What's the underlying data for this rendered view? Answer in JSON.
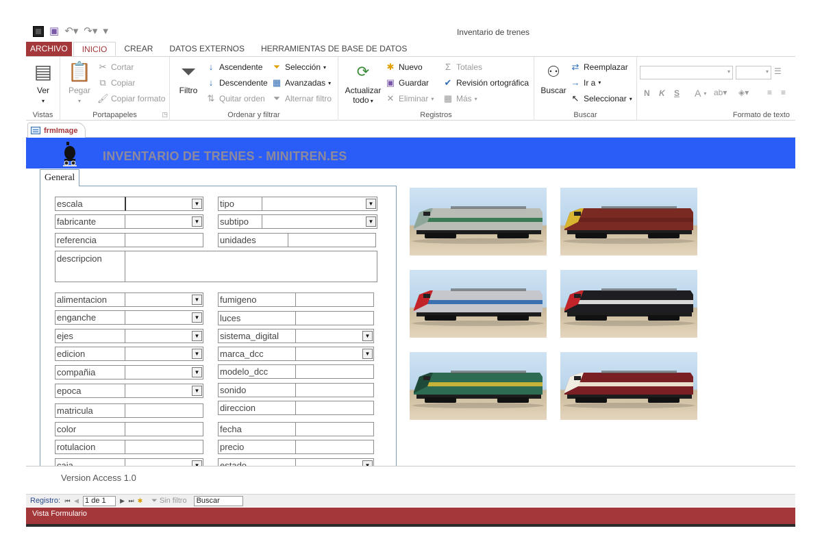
{
  "window": {
    "title": "Inventario de trenes"
  },
  "qat": {
    "icons": [
      "access-app-icon",
      "save-icon",
      "undo-icon",
      "redo-icon",
      "customize-icon"
    ]
  },
  "ribbon": {
    "tabs": [
      "ARCHIVO",
      "INICIO",
      "CREAR",
      "DATOS EXTERNOS",
      "HERRAMIENTAS DE BASE DE DATOS"
    ],
    "active_tab": "INICIO",
    "groups": {
      "vistas": {
        "label": "Vistas",
        "ver": "Ver"
      },
      "portapapeles": {
        "label": "Portapapeles",
        "pegar": "Pegar",
        "cortar": "Cortar",
        "copiar": "Copiar",
        "copiar_formato": "Copiar formato"
      },
      "ordenar": {
        "label": "Ordenar y filtrar",
        "filtro": "Filtro",
        "ascendente": "Ascendente",
        "descendente": "Descendente",
        "quitar_orden": "Quitar orden",
        "seleccion": "Selección",
        "avanzadas": "Avanzadas",
        "alternar_filtro": "Alternar filtro"
      },
      "registros": {
        "label": "Registros",
        "actualizar": "Actualizar",
        "todo": "todo",
        "nuevo": "Nuevo",
        "guardar": "Guardar",
        "eliminar": "Eliminar",
        "totales": "Totales",
        "revision": "Revisión ortográfica",
        "mas": "Más"
      },
      "buscar": {
        "label": "Buscar",
        "buscar": "Buscar",
        "reemplazar": "Reemplazar",
        "ir_a": "Ir a",
        "seleccionar": "Seleccionar"
      },
      "formato": {
        "label": "Formato de texto",
        "bold": "N",
        "italic": "K",
        "underline": "S",
        "font_color": "A"
      }
    }
  },
  "object_tab": {
    "name": "frmImage"
  },
  "form": {
    "title": "INVENTARIO DE TRENES - MINITREN.ES",
    "page_tab": "General",
    "fields_left": [
      "escala",
      "fabricante",
      "referencia",
      "descripcion",
      "alimentacion",
      "enganche",
      "ejes",
      "edicion",
      "compañia",
      "epoca",
      "matricula",
      "color",
      "rotulacion",
      "caja"
    ],
    "fields_right": [
      "tipo",
      "subtipo",
      "unidades",
      "fumigeno",
      "luces",
      "sistema_digital",
      "marca_dcc",
      "modelo_dcc",
      "sonido",
      "direccion",
      "fecha",
      "precio",
      "estado"
    ],
    "version": "Version Access 1.0"
  },
  "photos": [
    {
      "name": "locomotive-silver-green",
      "body": "#b9bdb6",
      "stripe": "#3c7a55",
      "accent": "#8fa79a"
    },
    {
      "name": "locomotive-brown-yellow",
      "body": "#7a2a22",
      "stripe": "#6a221c",
      "accent": "#d8b530"
    },
    {
      "name": "locomotive-grey-red",
      "body": "#c5c7cc",
      "stripe": "#3a6fb0",
      "accent": "#c2242a"
    },
    {
      "name": "locomotive-black-red",
      "body": "#1e1e22",
      "stripe": "#d9d9d9",
      "accent": "#c2242a"
    },
    {
      "name": "locomotive-green-yellow",
      "body": "#2d6b52",
      "stripe": "#c6b33a",
      "accent": "#1e4a3a"
    },
    {
      "name": "locomotive-maroon-cream",
      "body": "#7a1f24",
      "stripe": "#e8dfcf",
      "accent": "#f2ede3"
    }
  ],
  "navigator": {
    "label": "Registro:",
    "record": "1 de 1",
    "no_filter": "Sin filtro",
    "search": "Buscar"
  },
  "status": {
    "view": "Vista Formulario"
  },
  "colors": {
    "accent": "#a4373a",
    "header_blue": "#2a5df7",
    "title_grey": "#8e8a9d"
  }
}
